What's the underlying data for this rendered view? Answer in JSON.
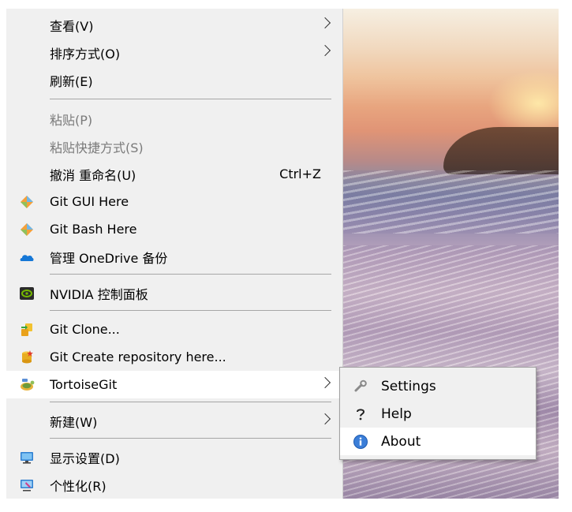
{
  "context_menu": {
    "view": {
      "label": "查看(V)"
    },
    "sort": {
      "label": "排序方式(O)"
    },
    "refresh": {
      "label": "刷新(E)"
    },
    "paste": {
      "label": "粘贴(P)"
    },
    "paste_shortcut": {
      "label": "粘贴快捷方式(S)"
    },
    "undo_rename": {
      "label": "撤消 重命名(U)",
      "shortcut": "Ctrl+Z"
    },
    "git_gui": {
      "label": "Git GUI Here"
    },
    "git_bash": {
      "label": "Git Bash Here"
    },
    "onedrive_backup": {
      "label": "管理 OneDrive 备份"
    },
    "nvidia": {
      "label": "NVIDIA 控制面板"
    },
    "git_clone": {
      "label": "Git Clone..."
    },
    "git_create_repo": {
      "label": "Git Create repository here..."
    },
    "tortoisegit": {
      "label": "TortoiseGit"
    },
    "new": {
      "label": "新建(W)"
    },
    "display_settings": {
      "label": "显示设置(D)"
    },
    "personalize": {
      "label": "个性化(R)"
    }
  },
  "tortoisegit_submenu": {
    "settings": {
      "label": "Settings"
    },
    "help": {
      "label": "Help"
    },
    "about": {
      "label": "About"
    }
  },
  "colors": {
    "menu_bg": "#f0f0f0",
    "hover_bg": "#ffffff",
    "disabled_text": "#7a7a7a",
    "separator": "#a6a6a6"
  }
}
